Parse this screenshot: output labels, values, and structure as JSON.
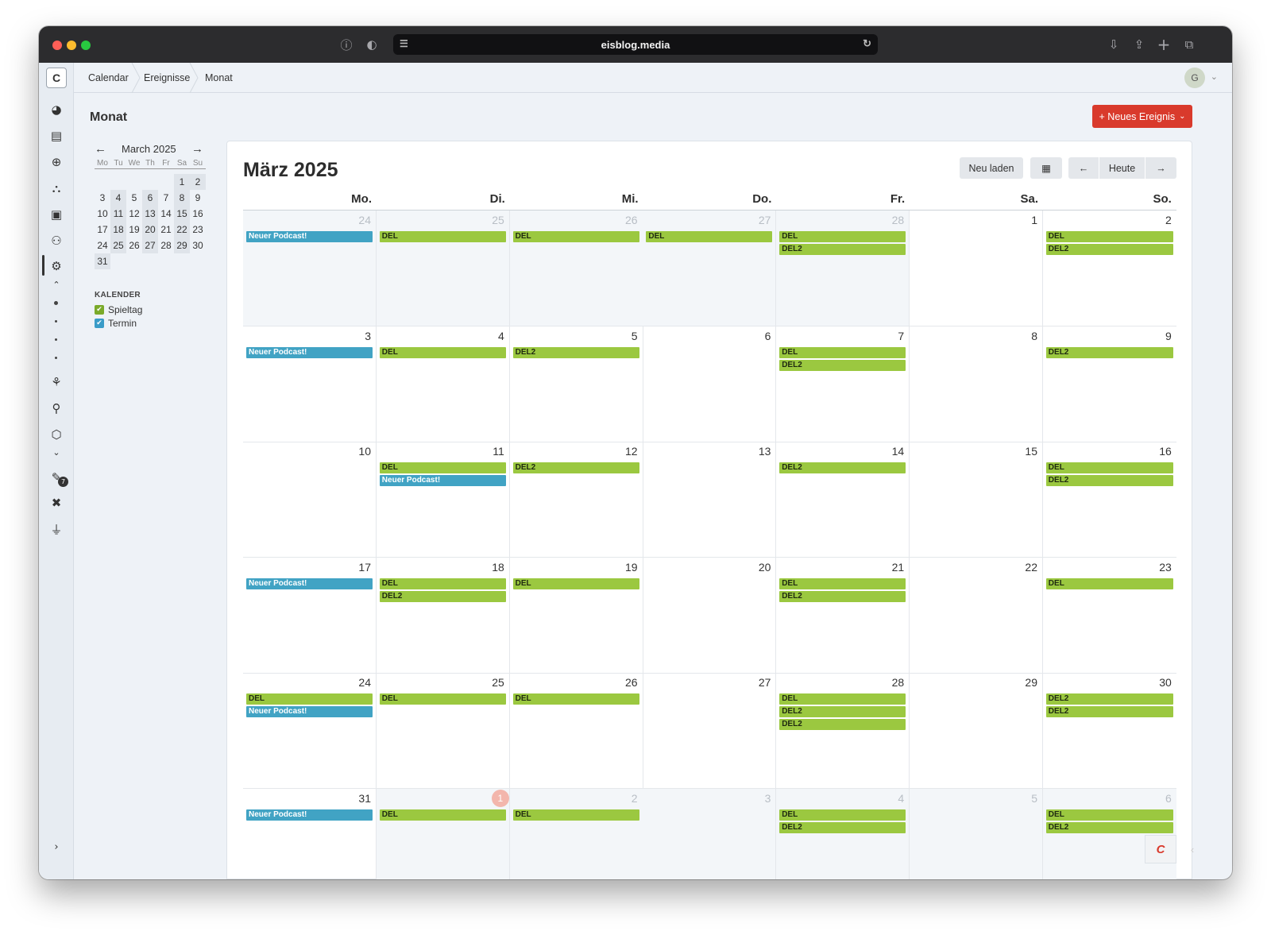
{
  "browser": {
    "url": "eisblog.media",
    "colors": {
      "close": "#ff5f57",
      "min": "#febc2e",
      "max": "#28c840"
    }
  },
  "sidebar": {
    "logo": "C",
    "badge": "7",
    "icons": [
      "gauge-icon",
      "news-icon",
      "globe-icon",
      "sitemap-icon",
      "image-icon",
      "users-icon",
      "calendar-plugin-icon",
      "chevron-up-icon",
      "dot-icon",
      "dot-icon",
      "dot-icon",
      "dot-icon",
      "plugin-icon",
      "tools-icon",
      "hexagon-icon",
      "chevron-down-icon",
      "wrench-icon",
      "bug-icon",
      "plug-icon",
      "expand-icon"
    ]
  },
  "breadcrumb": [
    "Calendar",
    "Ereignisse",
    "Monat"
  ],
  "user": {
    "initial": "G"
  },
  "page": {
    "title": "Monat",
    "new_button": "+ Neues Ereignis",
    "new_button_color": "#d93a2c"
  },
  "mini": {
    "title": "March 2025",
    "prev": "←",
    "next": "→",
    "dow": [
      "Mo",
      "Tu",
      "We",
      "Th",
      "Fr",
      "Sa",
      "Su"
    ],
    "weeks": [
      [
        "",
        "",
        "",
        "",
        "",
        "1",
        "2"
      ],
      [
        "3",
        "4",
        "5",
        "6",
        "7",
        "8",
        "9"
      ],
      [
        "10",
        "11",
        "12",
        "13",
        "14",
        "15",
        "16"
      ],
      [
        "17",
        "18",
        "19",
        "20",
        "21",
        "22",
        "23"
      ],
      [
        "24",
        "25",
        "26",
        "27",
        "28",
        "29",
        "30"
      ],
      [
        "31",
        "",
        "",
        "",
        "",
        "",
        ""
      ]
    ]
  },
  "calendars": {
    "title": "KALENDER",
    "items": [
      {
        "label": "Spieltag",
        "color": "#7aaa2a"
      },
      {
        "label": "Termin",
        "color": "#3a9cc8"
      }
    ]
  },
  "calendar": {
    "title": "März 2025",
    "buttons": {
      "reload": "Neu laden",
      "picker": "▦",
      "prev": "←",
      "today": "Heute",
      "next": "→"
    },
    "days": [
      "Mo.",
      "Di.",
      "Mi.",
      "Do.",
      "Fr.",
      "Sa.",
      "So."
    ],
    "today_label": "1",
    "weeks": [
      [
        {
          "n": "24",
          "other": true,
          "ev": [
            [
              "Neuer Podcast!",
              "blue"
            ]
          ]
        },
        {
          "n": "25",
          "other": true,
          "ev": [
            [
              "DEL",
              "green"
            ]
          ]
        },
        {
          "n": "26",
          "other": true,
          "ev": [
            [
              "DEL",
              "green"
            ]
          ]
        },
        {
          "n": "27",
          "other": true,
          "ev": [
            [
              "DEL",
              "green"
            ]
          ]
        },
        {
          "n": "28",
          "other": true,
          "ev": [
            [
              "DEL",
              "green"
            ],
            [
              "DEL2",
              "green"
            ]
          ]
        },
        {
          "n": "1",
          "ev": []
        },
        {
          "n": "2",
          "ev": [
            [
              "DEL",
              "green"
            ],
            [
              "DEL2",
              "green"
            ]
          ]
        }
      ],
      [
        {
          "n": "3",
          "ev": [
            [
              "Neuer Podcast!",
              "blue"
            ]
          ]
        },
        {
          "n": "4",
          "ev": [
            [
              "DEL",
              "green"
            ]
          ]
        },
        {
          "n": "5",
          "ev": [
            [
              "DEL2",
              "green"
            ]
          ]
        },
        {
          "n": "6",
          "ev": []
        },
        {
          "n": "7",
          "ev": [
            [
              "DEL",
              "green"
            ],
            [
              "DEL2",
              "green"
            ]
          ]
        },
        {
          "n": "8",
          "ev": []
        },
        {
          "n": "9",
          "ev": [
            [
              "DEL2",
              "green"
            ]
          ]
        }
      ],
      [
        {
          "n": "10",
          "ev": []
        },
        {
          "n": "11",
          "ev": [
            [
              "DEL",
              "green"
            ],
            [
              "Neuer Podcast!",
              "blue"
            ]
          ]
        },
        {
          "n": "12",
          "ev": [
            [
              "DEL2",
              "green"
            ]
          ]
        },
        {
          "n": "13",
          "ev": []
        },
        {
          "n": "14",
          "ev": [
            [
              "DEL2",
              "green"
            ]
          ]
        },
        {
          "n": "15",
          "ev": []
        },
        {
          "n": "16",
          "ev": [
            [
              "DEL",
              "green"
            ],
            [
              "DEL2",
              "green"
            ]
          ]
        }
      ],
      [
        {
          "n": "17",
          "ev": [
            [
              "Neuer Podcast!",
              "blue"
            ]
          ]
        },
        {
          "n": "18",
          "ev": [
            [
              "DEL",
              "green"
            ],
            [
              "DEL2",
              "green"
            ]
          ]
        },
        {
          "n": "19",
          "ev": [
            [
              "DEL",
              "green"
            ]
          ]
        },
        {
          "n": "20",
          "ev": []
        },
        {
          "n": "21",
          "ev": [
            [
              "DEL",
              "green"
            ],
            [
              "DEL2",
              "green"
            ]
          ]
        },
        {
          "n": "22",
          "ev": []
        },
        {
          "n": "23",
          "ev": [
            [
              "DEL",
              "green"
            ]
          ]
        }
      ],
      [
        {
          "n": "24",
          "ev": [
            [
              "DEL",
              "green"
            ],
            [
              "Neuer Podcast!",
              "blue"
            ]
          ]
        },
        {
          "n": "25",
          "ev": [
            [
              "DEL",
              "green"
            ]
          ]
        },
        {
          "n": "26",
          "ev": [
            [
              "DEL",
              "green"
            ]
          ]
        },
        {
          "n": "27",
          "ev": []
        },
        {
          "n": "28",
          "ev": [
            [
              "DEL",
              "green"
            ],
            [
              "DEL2",
              "green"
            ],
            [
              "DEL2",
              "green"
            ]
          ]
        },
        {
          "n": "29",
          "ev": []
        },
        {
          "n": "30",
          "ev": [
            [
              "DEL2",
              "green"
            ],
            [
              "DEL2",
              "green"
            ]
          ]
        }
      ],
      [
        {
          "n": "31",
          "ev": [
            [
              "Neuer Podcast!",
              "blue"
            ]
          ]
        },
        {
          "n": "1",
          "other": true,
          "today": true,
          "ev": [
            [
              "DEL",
              "green"
            ]
          ]
        },
        {
          "n": "2",
          "other": true,
          "ev": [
            [
              "DEL",
              "green"
            ]
          ]
        },
        {
          "n": "3",
          "other": true,
          "ev": []
        },
        {
          "n": "4",
          "other": true,
          "ev": [
            [
              "DEL",
              "green"
            ],
            [
              "DEL2",
              "green"
            ]
          ]
        },
        {
          "n": "5",
          "other": true,
          "ev": []
        },
        {
          "n": "6",
          "other": true,
          "ev": [
            [
              "DEL",
              "green"
            ],
            [
              "DEL2",
              "green"
            ]
          ]
        }
      ]
    ]
  },
  "brand": {
    "logo": "C",
    "collapse": "‹"
  }
}
